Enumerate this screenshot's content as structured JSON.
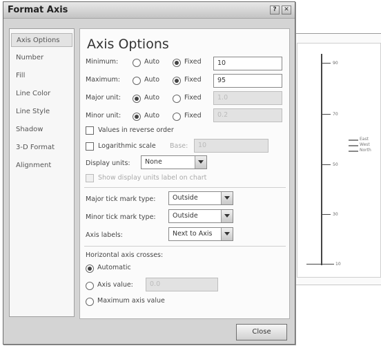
{
  "window": {
    "title": "Format Axis",
    "help_glyph": "?",
    "close_glyph": "✕"
  },
  "sidebar": {
    "items": [
      {
        "label": "Axis Options",
        "selected": true
      },
      {
        "label": "Number"
      },
      {
        "label": "Fill"
      },
      {
        "label": "Line Color"
      },
      {
        "label": "Line Style"
      },
      {
        "label": "Shadow"
      },
      {
        "label": "3-D Format"
      },
      {
        "label": "Alignment"
      }
    ]
  },
  "axis_options": {
    "heading": "Axis Options",
    "auto_label": "Auto",
    "fixed_label": "Fixed",
    "rows": [
      {
        "label": "Minimum:",
        "selected": "fixed",
        "value": "10"
      },
      {
        "label": "Maximum:",
        "selected": "fixed",
        "value": "95"
      },
      {
        "label": "Major unit:",
        "selected": "auto",
        "value": "1.0"
      },
      {
        "label": "Minor unit:",
        "selected": "auto",
        "value": "0.2"
      }
    ],
    "values_reverse": "Values in reverse order",
    "log_scale": "Logarithmic scale",
    "base_label": "Base:",
    "base_value": "10",
    "display_units_label": "Display units:",
    "display_units_value": "None",
    "show_units_label": "Show display units label on chart",
    "major_tick_label": "Major tick mark type:",
    "major_tick_value": "Outside",
    "minor_tick_label": "Minor tick mark type:",
    "minor_tick_value": "Outside",
    "axis_labels_label": "Axis labels:",
    "axis_labels_value": "Next to Axis",
    "h_axis_crosses_label": "Horizontal axis crosses:",
    "automatic_label": "Automatic",
    "axis_value_label": "Axis value:",
    "axis_value": "0.0",
    "max_axis_value_label": "Maximum axis value",
    "crosses_selected": "automatic"
  },
  "buttons": {
    "close": "Close"
  },
  "chart": {
    "tick_labels": [
      "90",
      "70",
      "50",
      "30",
      "10"
    ],
    "legend": [
      "East",
      "West",
      "North"
    ]
  }
}
